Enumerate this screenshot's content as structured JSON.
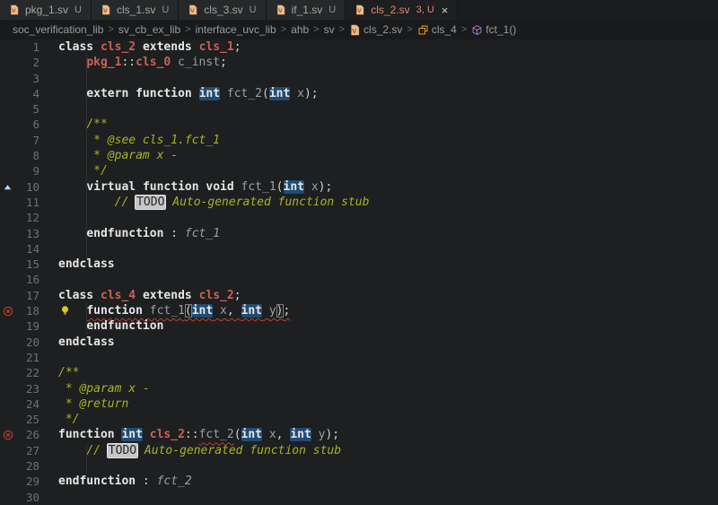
{
  "colors": {
    "editor_bg": "#1d1f20",
    "tab_active_text": "#e48771",
    "tab_inactive_text": "#a6a6a6",
    "class_name": "#c96157",
    "keyword": "#e6e6e6",
    "identifier": "#9aa0a5",
    "comment": "#a8b422",
    "occurrence_highlight_bg": "#1f4c73",
    "error": "#c0402f",
    "todo_bg": "#c6c6c6",
    "line_number": "#6d7175",
    "file_icon": "#e7c088",
    "class_icon": "#ee9d28",
    "method_icon": "#b180d7",
    "override_icon": "#b6d4ee",
    "lightbulb_icon": "#dfc71c"
  },
  "tabs": [
    {
      "label": "pkg_1.sv",
      "badge": "U",
      "active": false
    },
    {
      "label": "cls_1.sv",
      "badge": "U",
      "active": false
    },
    {
      "label": "cls_3.sv",
      "badge": "U",
      "active": false
    },
    {
      "label": "if_1.sv",
      "badge": "U",
      "active": false
    },
    {
      "label": "cls_2.sv",
      "badge": "3, U",
      "active": true,
      "close_label": "×"
    }
  ],
  "breadcrumb": [
    {
      "label": "soc_verification_lib",
      "icon": null
    },
    {
      "label": "sv_cb_ex_lib",
      "icon": null
    },
    {
      "label": "interface_uvc_lib",
      "icon": null
    },
    {
      "label": "ahb",
      "icon": null
    },
    {
      "label": "sv",
      "icon": null
    },
    {
      "label": "cls_2.sv",
      "icon": "file"
    },
    {
      "label": "cls_4",
      "icon": "class"
    },
    {
      "label": "fct_1()",
      "icon": "method"
    }
  ],
  "editor": {
    "lines": [
      {
        "n": 1,
        "icon": null,
        "bulb": false,
        "guide": false,
        "tokens": [
          [
            "class ",
            "kw"
          ],
          [
            "cls_2",
            "type"
          ],
          [
            " ",
            "pln"
          ],
          [
            "extends",
            "kw"
          ],
          [
            " ",
            "pln"
          ],
          [
            "cls_1",
            "type"
          ],
          [
            ";",
            "pln"
          ]
        ]
      },
      {
        "n": 2,
        "icon": null,
        "bulb": false,
        "guide": true,
        "tokens": [
          [
            "    ",
            "pln"
          ],
          [
            "pkg_1",
            "type"
          ],
          [
            "::",
            "pln"
          ],
          [
            "cls_0",
            "type"
          ],
          [
            " ",
            "pln"
          ],
          [
            "c_inst",
            "id"
          ],
          [
            ";",
            "pln"
          ]
        ]
      },
      {
        "n": 3,
        "icon": null,
        "bulb": false,
        "guide": true,
        "tokens": []
      },
      {
        "n": 4,
        "icon": null,
        "bulb": false,
        "guide": true,
        "tokens": [
          [
            "    ",
            "pln"
          ],
          [
            "extern",
            "kw"
          ],
          [
            " ",
            "pln"
          ],
          [
            "function",
            "kw"
          ],
          [
            " ",
            "pln"
          ],
          [
            "int",
            "kw hl"
          ],
          [
            " ",
            "pln"
          ],
          [
            "fct_2",
            "id"
          ],
          [
            "(",
            "pln"
          ],
          [
            "int",
            "kw hl"
          ],
          [
            " ",
            "pln"
          ],
          [
            "x",
            "id"
          ],
          [
            ");",
            "pln"
          ]
        ]
      },
      {
        "n": 5,
        "icon": null,
        "bulb": false,
        "guide": true,
        "tokens": []
      },
      {
        "n": 6,
        "icon": null,
        "bulb": false,
        "guide": true,
        "tokens": [
          [
            "    ",
            "pln"
          ],
          [
            "/**",
            "doc"
          ]
        ]
      },
      {
        "n": 7,
        "icon": null,
        "bulb": false,
        "guide": true,
        "tokens": [
          [
            "     * @see cls_1.fct_1",
            "doc"
          ]
        ]
      },
      {
        "n": 8,
        "icon": null,
        "bulb": false,
        "guide": true,
        "tokens": [
          [
            "     * @param x -",
            "doc"
          ]
        ]
      },
      {
        "n": 9,
        "icon": null,
        "bulb": false,
        "guide": true,
        "tokens": [
          [
            "     */",
            "doc"
          ]
        ]
      },
      {
        "n": 10,
        "icon": "triangle",
        "bulb": false,
        "guide": true,
        "tokens": [
          [
            "    ",
            "pln"
          ],
          [
            "virtual",
            "kw"
          ],
          [
            " ",
            "pln"
          ],
          [
            "function",
            "kw"
          ],
          [
            " ",
            "pln"
          ],
          [
            "void",
            "kw"
          ],
          [
            " ",
            "pln"
          ],
          [
            "fct_1",
            "id"
          ],
          [
            "(",
            "pln"
          ],
          [
            "int",
            "kw hl"
          ],
          [
            " ",
            "pln"
          ],
          [
            "x",
            "id"
          ],
          [
            ");",
            "pln"
          ]
        ]
      },
      {
        "n": 11,
        "icon": null,
        "bulb": false,
        "guide": true,
        "tokens": [
          [
            "        ",
            "pln"
          ],
          [
            "// ",
            "doc"
          ],
          [
            "TODO",
            "todo"
          ],
          [
            " Auto-generated function stub",
            "doc"
          ]
        ]
      },
      {
        "n": 12,
        "icon": null,
        "bulb": false,
        "guide": true,
        "tokens": []
      },
      {
        "n": 13,
        "icon": null,
        "bulb": false,
        "guide": true,
        "tokens": [
          [
            "    ",
            "pln"
          ],
          [
            "endfunction",
            "kw"
          ],
          [
            " : ",
            "pln"
          ],
          [
            "fct_1",
            "ital"
          ]
        ]
      },
      {
        "n": 14,
        "icon": null,
        "bulb": false,
        "guide": true,
        "tokens": []
      },
      {
        "n": 15,
        "icon": null,
        "bulb": false,
        "guide": false,
        "tokens": [
          [
            "endclass",
            "kw"
          ]
        ]
      },
      {
        "n": 16,
        "icon": null,
        "bulb": false,
        "guide": false,
        "tokens": []
      },
      {
        "n": 17,
        "icon": null,
        "bulb": false,
        "guide": false,
        "tokens": [
          [
            "class ",
            "kw"
          ],
          [
            "cls_4",
            "type"
          ],
          [
            " ",
            "pln"
          ],
          [
            "extends",
            "kw"
          ],
          [
            " ",
            "pln"
          ],
          [
            "cls_2",
            "type"
          ],
          [
            ";",
            "pln"
          ]
        ]
      },
      {
        "n": 18,
        "icon": "error",
        "bulb": true,
        "guide": true,
        "tokens": [
          [
            "    ",
            "pln"
          ],
          [
            "function ",
            "kw sq"
          ],
          [
            "fct_1",
            "id sq"
          ],
          [
            "(",
            "pln sq box"
          ],
          [
            "int",
            "kw hl sq"
          ],
          [
            " ",
            "pln sq"
          ],
          [
            "x",
            "id sq"
          ],
          [
            ", ",
            "pln sq"
          ],
          [
            "int",
            "kw hl sq"
          ],
          [
            " ",
            "pln sq"
          ],
          [
            "y",
            "id sq"
          ],
          [
            ")",
            "pln sq box"
          ],
          [
            ";",
            "pln sq"
          ]
        ]
      },
      {
        "n": 19,
        "icon": null,
        "bulb": false,
        "guide": true,
        "tokens": [
          [
            "    ",
            "pln"
          ],
          [
            "endfunction",
            "kw"
          ]
        ]
      },
      {
        "n": 20,
        "icon": null,
        "bulb": false,
        "guide": false,
        "tokens": [
          [
            "endclass",
            "kw"
          ]
        ]
      },
      {
        "n": 21,
        "icon": null,
        "bulb": false,
        "guide": false,
        "tokens": []
      },
      {
        "n": 22,
        "icon": null,
        "bulb": false,
        "guide": false,
        "tokens": [
          [
            "/**",
            "doc"
          ]
        ]
      },
      {
        "n": 23,
        "icon": null,
        "bulb": false,
        "guide": false,
        "tokens": [
          [
            " * @param x -",
            "doc"
          ]
        ]
      },
      {
        "n": 24,
        "icon": null,
        "bulb": false,
        "guide": false,
        "tokens": [
          [
            " * @return",
            "doc"
          ]
        ]
      },
      {
        "n": 25,
        "icon": null,
        "bulb": false,
        "guide": false,
        "tokens": [
          [
            " */",
            "doc"
          ]
        ]
      },
      {
        "n": 26,
        "icon": "error",
        "bulb": false,
        "guide": false,
        "tokens": [
          [
            "function",
            "kw"
          ],
          [
            " ",
            "pln"
          ],
          [
            "int",
            "kw hl"
          ],
          [
            " ",
            "pln"
          ],
          [
            "cls_2",
            "type"
          ],
          [
            "::",
            "pln"
          ],
          [
            "fct_2",
            "id sq"
          ],
          [
            "(",
            "pln"
          ],
          [
            "int",
            "kw hl"
          ],
          [
            " ",
            "pln"
          ],
          [
            "x",
            "id"
          ],
          [
            ", ",
            "pln"
          ],
          [
            "int",
            "kw hl"
          ],
          [
            " ",
            "pln"
          ],
          [
            "y",
            "id"
          ],
          [
            ");",
            "pln"
          ]
        ]
      },
      {
        "n": 27,
        "icon": null,
        "bulb": false,
        "guide": true,
        "tokens": [
          [
            "    ",
            "pln"
          ],
          [
            "// ",
            "doc"
          ],
          [
            "TODO",
            "todo"
          ],
          [
            " Auto-generated function stub",
            "doc"
          ]
        ]
      },
      {
        "n": 28,
        "icon": null,
        "bulb": false,
        "guide": true,
        "tokens": []
      },
      {
        "n": 29,
        "icon": null,
        "bulb": false,
        "guide": false,
        "tokens": [
          [
            "endfunction",
            "kw"
          ],
          [
            " : ",
            "pln"
          ],
          [
            "fct_2",
            "ital"
          ]
        ]
      },
      {
        "n": 30,
        "icon": null,
        "bulb": false,
        "guide": false,
        "tokens": []
      }
    ]
  }
}
